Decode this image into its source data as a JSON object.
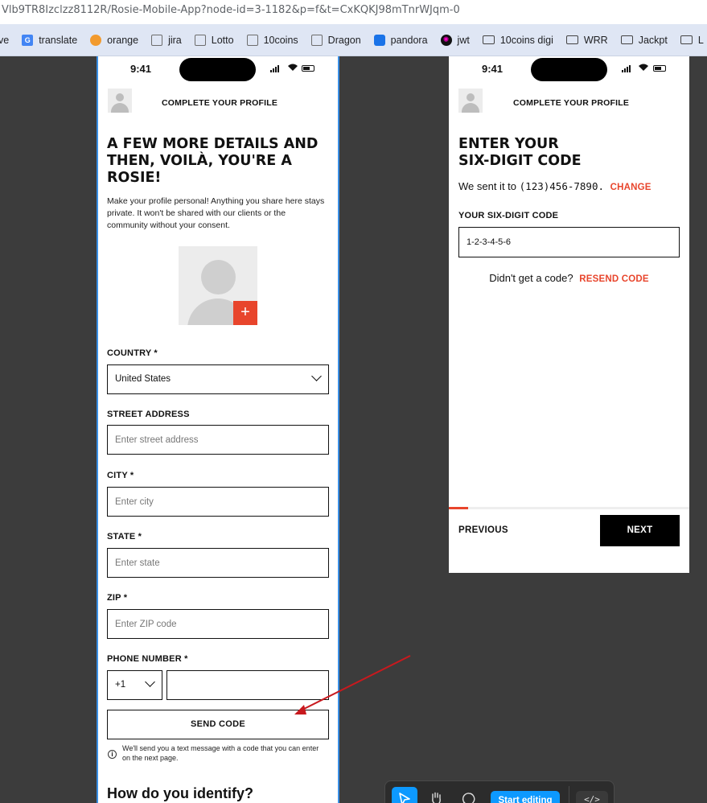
{
  "browser": {
    "url": "Vlb9TR8Izclzz8112R/Rosie-Mobile-App?node-id=3-1182&p=f&t=CxKQKJ98mTnrWJqm-0",
    "bookmarks": [
      {
        "label": "ve",
        "icon": "none"
      },
      {
        "label": "translate",
        "icon": "google-translate-icon"
      },
      {
        "label": "orange",
        "icon": "orange-icon"
      },
      {
        "label": "jira",
        "icon": "mosaic-icon"
      },
      {
        "label": "Lotto",
        "icon": "mosaic-icon"
      },
      {
        "label": "10coins",
        "icon": "mosaic-icon"
      },
      {
        "label": "Dragon",
        "icon": "mosaic-icon"
      },
      {
        "label": "pandora",
        "icon": "lock-icon"
      },
      {
        "label": "jwt",
        "icon": "jwt-icon"
      },
      {
        "label": "10coins digi",
        "icon": "folder-icon"
      },
      {
        "label": "WRR",
        "icon": "folder-icon"
      },
      {
        "label": "Jackpt",
        "icon": "folder-icon"
      },
      {
        "label": "L",
        "icon": "folder-icon"
      }
    ]
  },
  "profile_screen": {
    "time": "9:41",
    "header_title": "COMPLETE YOUR PROFILE",
    "heading_line1": "A FEW MORE DETAILS AND",
    "heading_line2": "THEN, VOILÀ, YOU'RE A",
    "heading_line3": "ROSIE!",
    "intro": "Make your profile personal! Anything you share here stays private. It won't be shared with our clients or the community without your consent.",
    "photo_add_symbol": "+",
    "country_label": "COUNTRY *",
    "country_value": "United States",
    "street_label": "STREET ADDRESS",
    "street_placeholder": "Enter street address",
    "city_label": "CITY *",
    "city_placeholder": "Enter city",
    "state_label": "STATE *",
    "state_placeholder": "Enter state",
    "zip_label": "ZIP *",
    "zip_placeholder": "Enter ZIP code",
    "phone_label": "PHONE NUMBER *",
    "phone_code": "+1",
    "phone_value": "",
    "send_code_label": "SEND CODE",
    "info_symbol": "i",
    "send_code_note": "We'll send you a text message with a code that you can enter on the next page.",
    "identify_heading": "How do you identify?"
  },
  "code_screen": {
    "time": "9:41",
    "header_title": "COMPLETE YOUR PROFILE",
    "heading_line1": "ENTER YOUR",
    "heading_line2": "SIX-DIGIT CODE",
    "sent_prefix": "We sent it to",
    "phone": "(123)456-7890.",
    "change_label": "CHANGE",
    "code_label": "YOUR SIX-DIGIT CODE",
    "code_value": "1-2-3-4-5-6",
    "no_code_text": "Didn't get a code?",
    "resend_label": "RESEND CODE",
    "progress_fraction": 0.08,
    "previous_label": "PREVIOUS",
    "next_label": "NEXT"
  },
  "toolbar": {
    "start_editing_label": "Start editing",
    "dev_mode_label": "</>"
  },
  "colors": {
    "accent": "#e8452c",
    "canvas": "#3c3c3c",
    "figma_blue": "#0d99ff",
    "annotation_arrow": "#c8191e"
  }
}
